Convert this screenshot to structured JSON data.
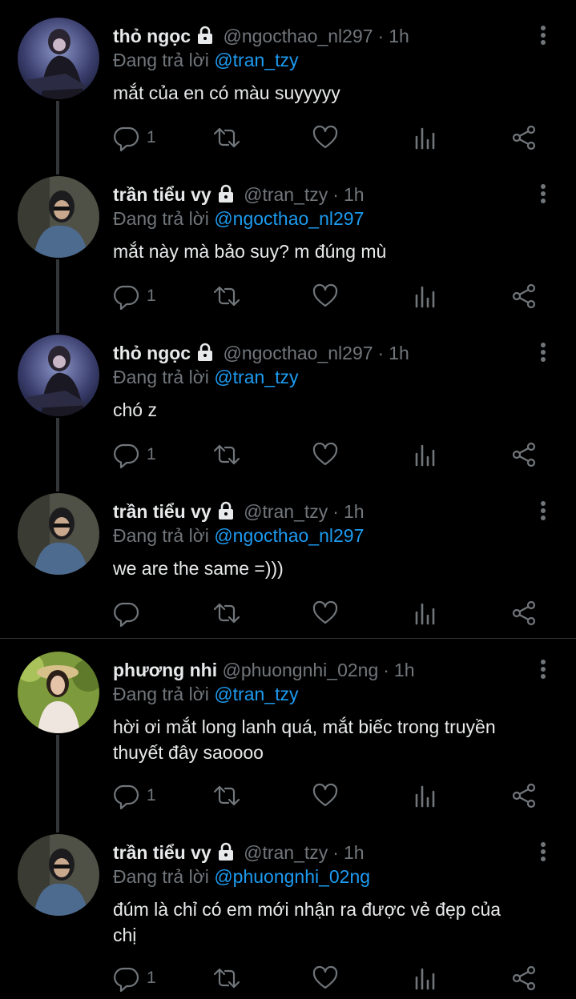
{
  "colors": {
    "background": "#000000",
    "text": "#e7e9ea",
    "secondary": "#71767b",
    "link": "#1d9bf0",
    "divider": "#2f3336"
  },
  "replying_prefix": "Đang trả lời",
  "tweets": [
    {
      "name": "thỏ ngọc",
      "locked": true,
      "handle": "@ngocthao_nl297",
      "time": "1h",
      "reply_to": "@tran_tzy",
      "lines": [
        "mắt của en có màu suyyyyy"
      ],
      "reply_count": "1",
      "avatar": "avatar-ngocthao"
    },
    {
      "name": "trần tiểu vy",
      "locked": true,
      "handle": "@tran_tzy",
      "time": "1h",
      "reply_to": "@ngocthao_nl297",
      "lines": [
        "mắt này mà bảo suy? m đúng mù"
      ],
      "reply_count": "1",
      "avatar": "avatar-tran-tzy"
    },
    {
      "name": "thỏ ngọc",
      "locked": true,
      "handle": "@ngocthao_nl297",
      "time": "1h",
      "reply_to": "@tran_tzy",
      "lines": [
        "chó z"
      ],
      "reply_count": "1",
      "avatar": "avatar-ngocthao"
    },
    {
      "name": "trần tiểu vy",
      "locked": true,
      "handle": "@tran_tzy",
      "time": "1h",
      "reply_to": "@ngocthao_nl297",
      "lines": [
        "we are the same =)))"
      ],
      "reply_count": "",
      "avatar": "avatar-tran-tzy"
    },
    {
      "name": "phương nhi",
      "locked": false,
      "handle": "@phuongnhi_02ng",
      "time": "1h",
      "reply_to": "@tran_tzy",
      "lines": [
        "hời ơi mắt long lanh quá, mắt biếc trong truyền",
        "thuyết đây saoooo"
      ],
      "reply_count": "1",
      "avatar": "avatar-phuongnhi"
    },
    {
      "name": "trần tiểu vy",
      "locked": true,
      "handle": "@tran_tzy",
      "time": "1h",
      "reply_to": "@phuongnhi_02ng",
      "lines": [
        "đúm là chỉ có em mới nhận ra được vẻ đẹp của",
        "chị"
      ],
      "reply_count": "1",
      "avatar": "avatar-tran-tzy"
    }
  ],
  "icons": {
    "reply": "reply-icon",
    "retweet": "retweet-icon",
    "like": "heart-icon",
    "views": "views-icon",
    "share": "share-icon",
    "more": "more-vertical-icon",
    "lock": "lock-icon"
  }
}
